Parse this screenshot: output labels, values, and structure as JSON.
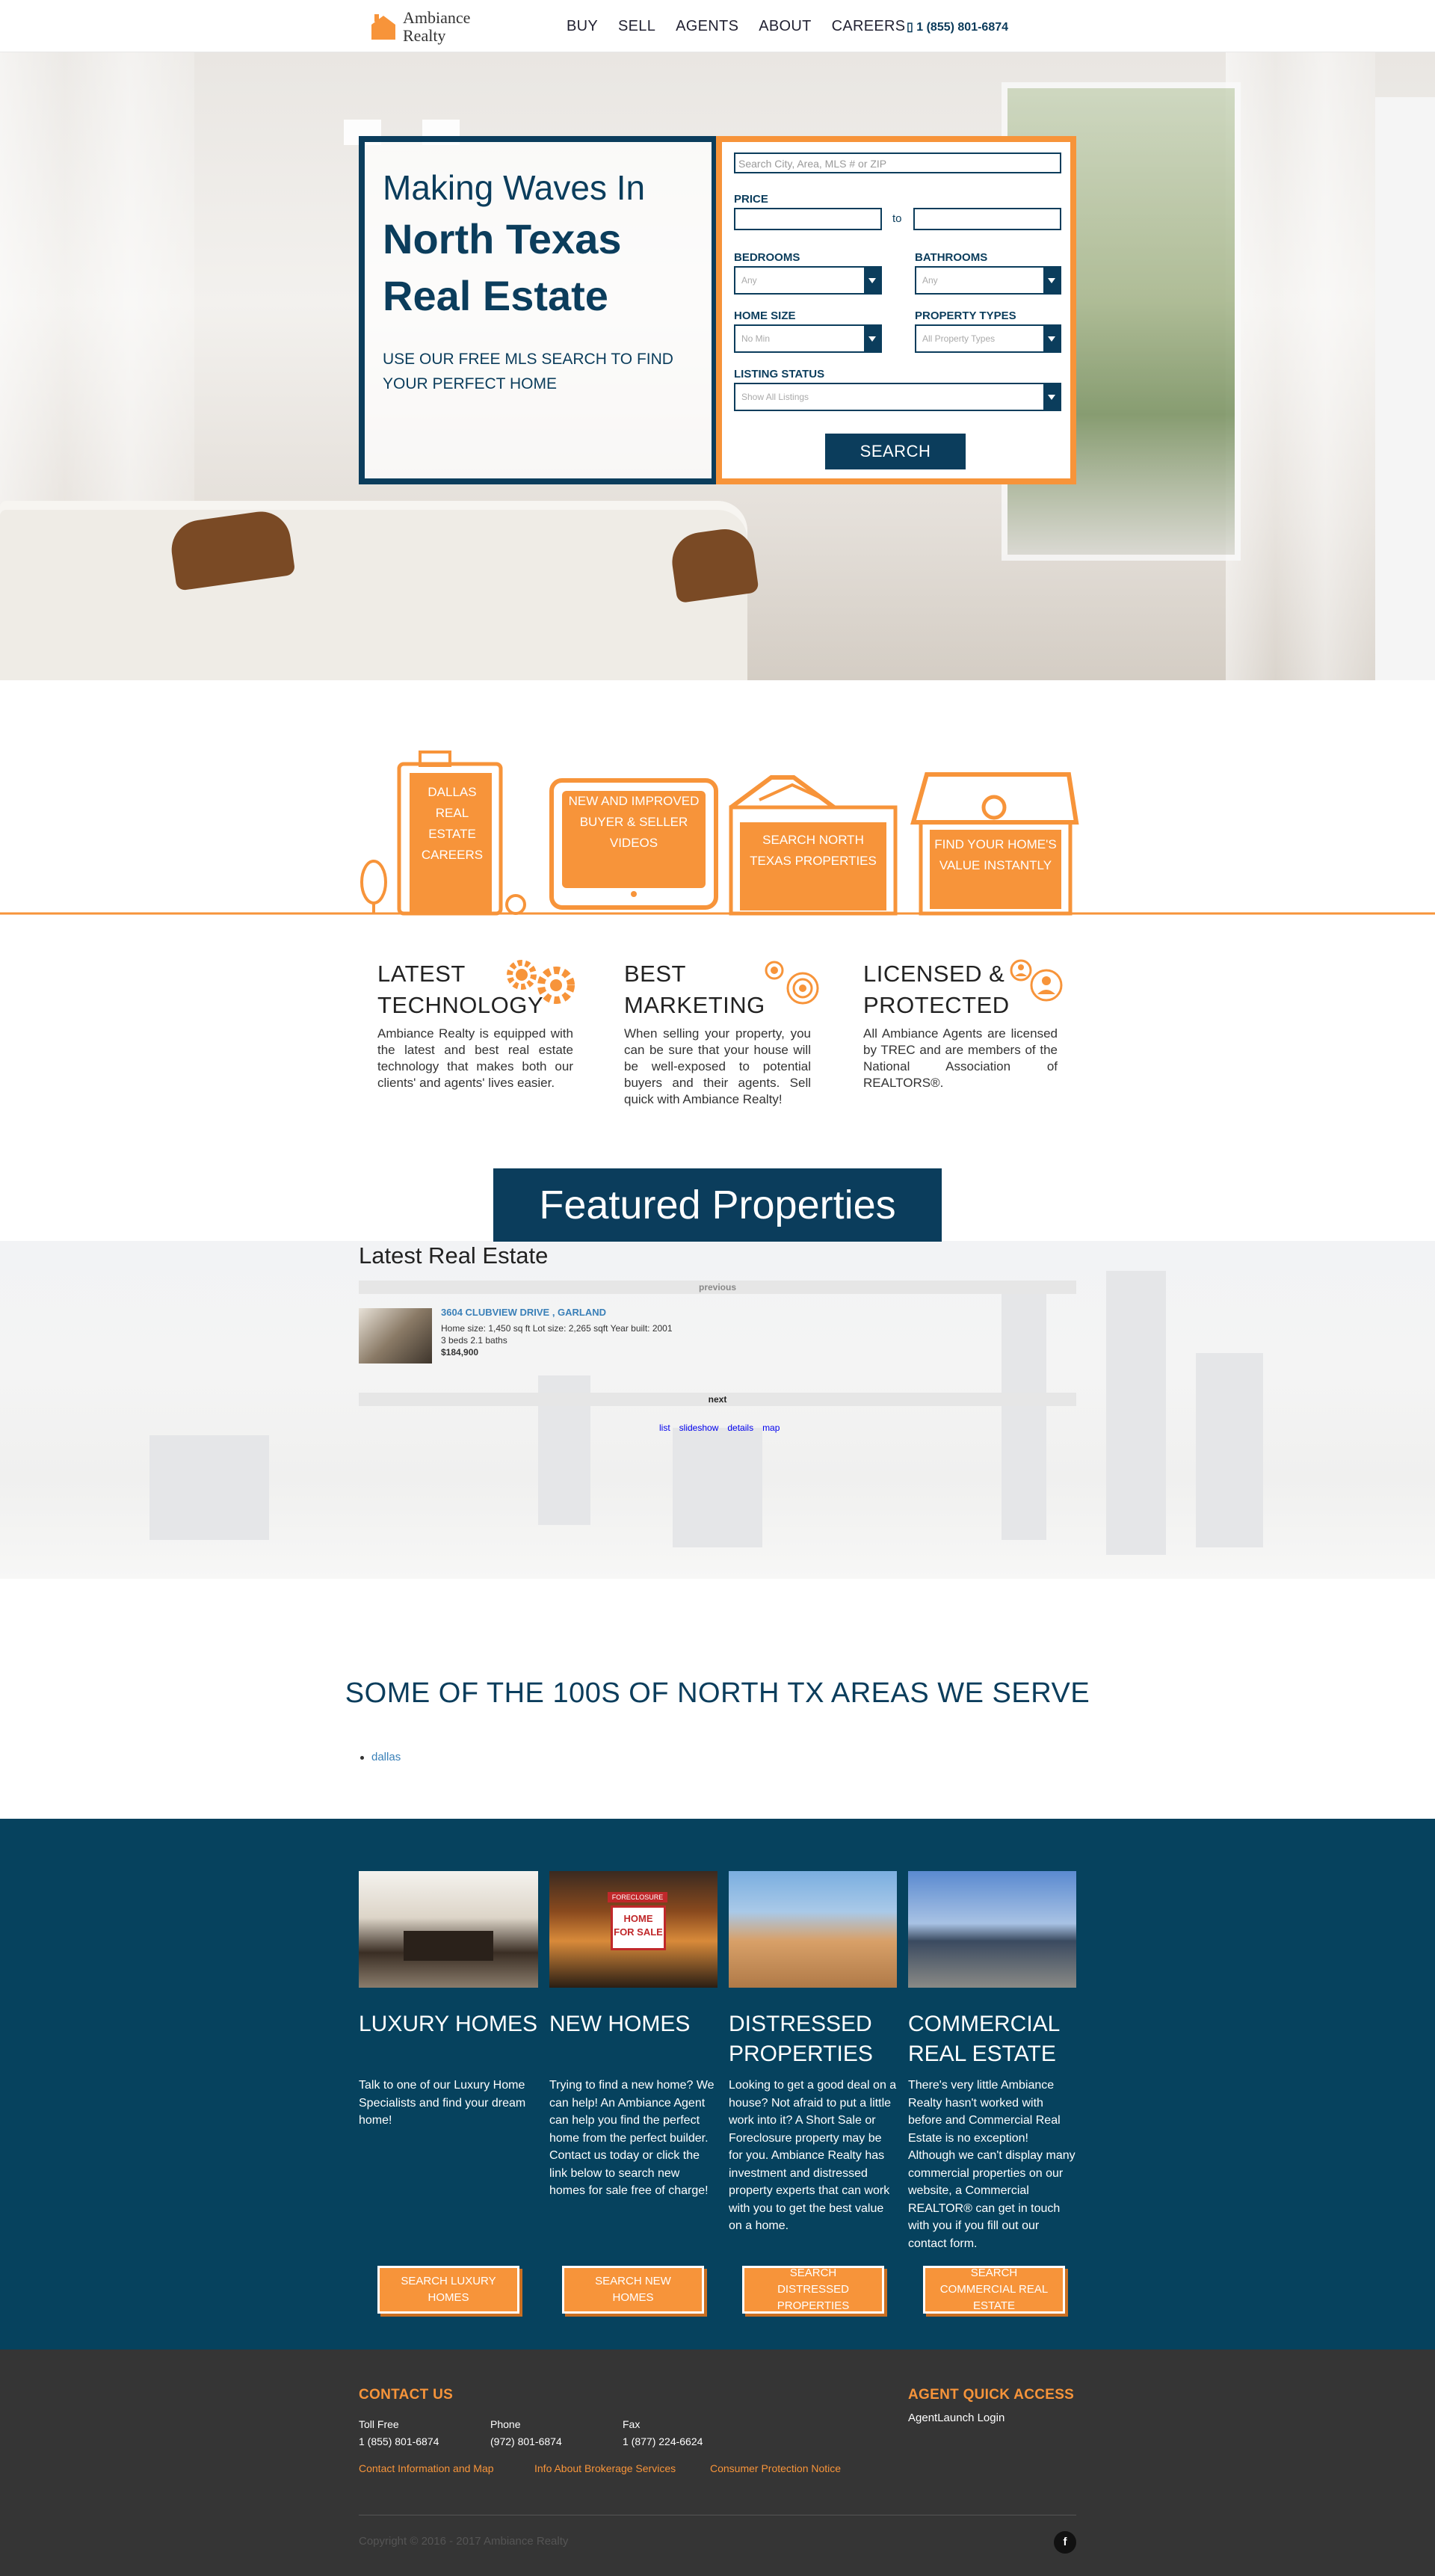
{
  "header": {
    "logo_line1": "Ambiance",
    "logo_line2": "Realty",
    "nav": [
      "BUY",
      "SELL",
      "AGENTS",
      "ABOUT",
      "CAREERS"
    ],
    "phone": "1 (855) 801-6874"
  },
  "hero": {
    "title_line1": "Making Waves In",
    "title_line2": "North Texas Real Estate",
    "subtitle": "USE OUR FREE MLS SEARCH TO FIND YOUR PERFECT HOME",
    "search_placeholder": "Search City, Area, MLS # or ZIP",
    "price_label": "PRICE",
    "price_to": "to",
    "bedrooms_label": "BEDROOMS",
    "bedrooms_value": "Any",
    "bathrooms_label": "BATHROOMS",
    "bathrooms_value": "Any",
    "home_size_label": "HOME SIZE",
    "home_size_value": "No Min",
    "property_types_label": "PROPERTY TYPES",
    "property_types_value": "All Property Types",
    "listing_status_label": "LISTING STATUS",
    "listing_status_value": "Show All Listings",
    "search_button": "SEARCH"
  },
  "buildings": [
    {
      "label": "DALLAS REAL ESTATE CAREERS"
    },
    {
      "label": "NEW AND IMPROVED BUYER & SELLER VIDEOS"
    },
    {
      "label": "SEARCH NORTH TEXAS PROPERTIES"
    },
    {
      "label": "FIND YOUR HOME'S VALUE INSTANTLY"
    }
  ],
  "features": [
    {
      "title": "LATEST TECHNOLOGY",
      "icon": "gears-icon",
      "text": "Ambiance Realty is equipped with the latest and best real estate technology that makes both our clients' and agents' lives easier."
    },
    {
      "title": "BEST MARKETING",
      "icon": "target-icon",
      "text": "When selling your property, you can be sure that your house will be well-exposed to potential buyers and their agents. Sell quick with Ambiance Realty!"
    },
    {
      "title": "LICENSED & PROTECTED",
      "icon": "people-icon",
      "text": "All Ambiance Agents are licensed by TREC and are members of the National Association of REALTORS®."
    }
  ],
  "featured": {
    "banner": "Featured Properties",
    "heading": "Latest Real Estate",
    "previous": "previous",
    "next": "next",
    "listing": {
      "title": "3604 CLUBVIEW DRIVE , GARLAND",
      "details": "Home size: 1,450 sq ft Lot size: 2,265 sqft Year built: 2001",
      "beds_baths": "3 beds 2.1 baths",
      "price": "$184,900"
    },
    "views": [
      "list",
      "slideshow",
      "details",
      "map"
    ]
  },
  "areas": {
    "heading": "SOME OF THE 100S OF NORTH TX AREAS WE SERVE",
    "items": [
      "dallas"
    ]
  },
  "services": [
    {
      "title": "LUXURY HOMES",
      "text": "Talk to one of our Luxury Home Specialists and find your dream home!",
      "button": "SEARCH LUXURY HOMES"
    },
    {
      "title": "NEW HOMES",
      "text": "Trying to find a new home? We can help! An Ambiance Agent can help you find the perfect home from the perfect builder. Contact us today or click the link below to search new homes for sale free of charge!",
      "button": "SEARCH NEW HOMES",
      "sign_top": "FORECLOSURE",
      "sign_main": "HOME FOR SALE"
    },
    {
      "title": "DISTRESSED PROPERTIES",
      "text": "Looking to get a good deal on a house? Not afraid to put a little work into it? A Short Sale or Foreclosure property may be for you. Ambiance Realty has investment and distressed property experts that can work with you to get the best value on a home.",
      "button": "SEARCH DISTRESSED PROPERTIES"
    },
    {
      "title": "COMMERCIAL REAL ESTATE",
      "text": "There's very little Ambiance Realty hasn't worked with before and Commercial Real Estate is no exception! Although we can't display many commercial properties on our website, a Commercial REALTOR® can get in touch with you if you fill out our contact form.",
      "button": "SEARCH COMMERCIAL REAL ESTATE"
    }
  ],
  "footer": {
    "contact_heading": "CONTACT US",
    "toll_free_label": "Toll Free",
    "toll_free": "1 (855) 801-6874",
    "phone_label": "Phone",
    "phone": "(972) 801-6874",
    "fax_label": "Fax",
    "fax": "1 (877) 224-6624",
    "links": [
      "Contact Information and Map",
      "Info About Brokerage Services",
      "Consumer Protection Notice"
    ],
    "agent_heading": "AGENT QUICK ACCESS",
    "agent_link": "AgentLaunch Login",
    "copyright": "Copyright © 2016 - 2017 Ambiance Realty",
    "facebook": "f"
  },
  "colors": {
    "navy": "#0b3d5c",
    "orange": "#f7943a",
    "footer": "#353535",
    "services_bg": "#06425e"
  }
}
